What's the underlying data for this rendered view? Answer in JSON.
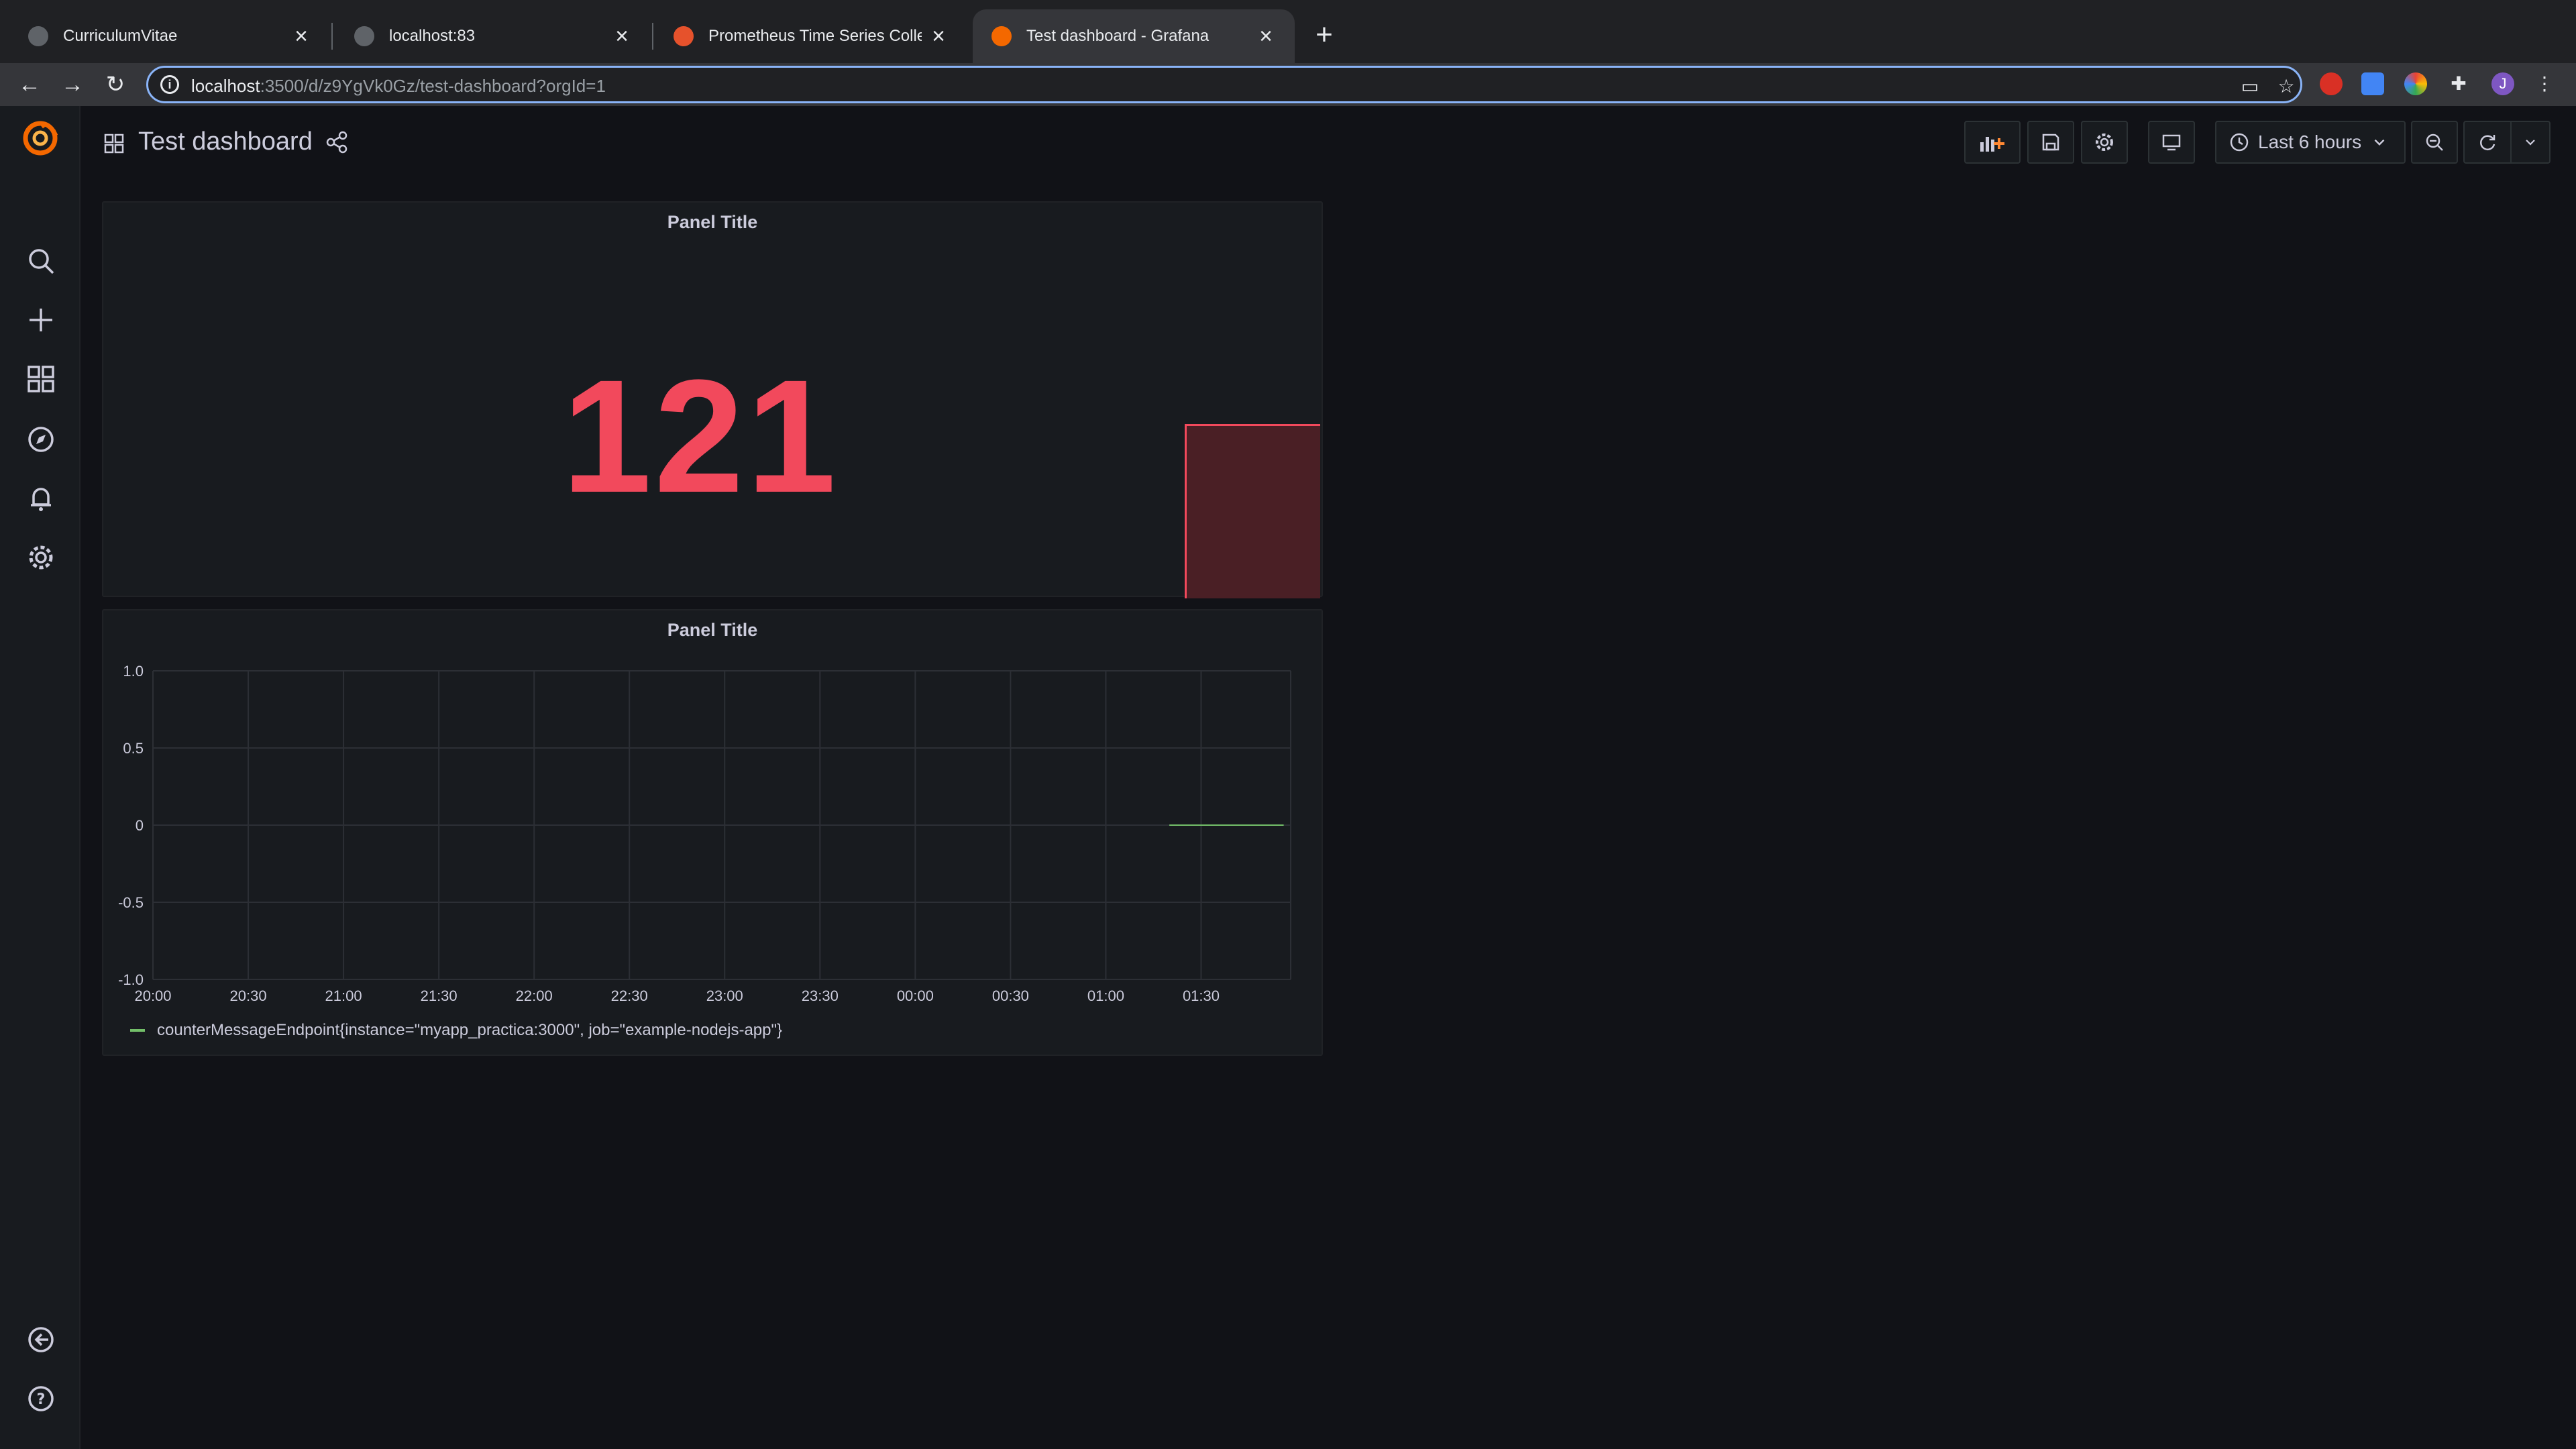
{
  "browser": {
    "tabs": [
      {
        "title": "CurriculumVitae",
        "active": false
      },
      {
        "title": "localhost:83",
        "active": false
      },
      {
        "title": "Prometheus Time Series Collec",
        "active": false
      },
      {
        "title": "Test dashboard - Grafana",
        "active": true
      }
    ],
    "url_host": "localhost",
    "url_path": ":3500/d/z9YgVk0Gz/test-dashboard?orgId=1",
    "profile_initial": "J"
  },
  "dashboard": {
    "title": "Test dashboard",
    "time_range": "Last 6 hours"
  },
  "panels": {
    "stat": {
      "title": "Panel Title",
      "value": "121",
      "color": "#f2495c"
    },
    "graph": {
      "title": "Panel Title",
      "legend": "counterMessageEndpoint{instance=\"myapp_practica:3000\", job=\"example-nodejs-app\"}"
    }
  },
  "chart_data": {
    "type": "line",
    "title": "Panel Title",
    "x": [
      "20:00",
      "20:30",
      "21:00",
      "21:30",
      "22:00",
      "22:30",
      "23:00",
      "23:30",
      "00:00",
      "00:30",
      "01:00",
      "01:30"
    ],
    "yticks": [
      "1.0",
      "0.5",
      "0",
      "-0.5",
      "-1.0"
    ],
    "ylim": [
      -1.0,
      1.0
    ],
    "grid": true,
    "legend_position": "bottom",
    "series": [
      {
        "name": "counterMessageEndpoint{instance=\"myapp_practica:3000\", job=\"example-nodejs-app\"}",
        "color": "#73bf69",
        "x_start": "01:20",
        "x_end": "01:56",
        "values": [
          0,
          0
        ]
      }
    ]
  }
}
